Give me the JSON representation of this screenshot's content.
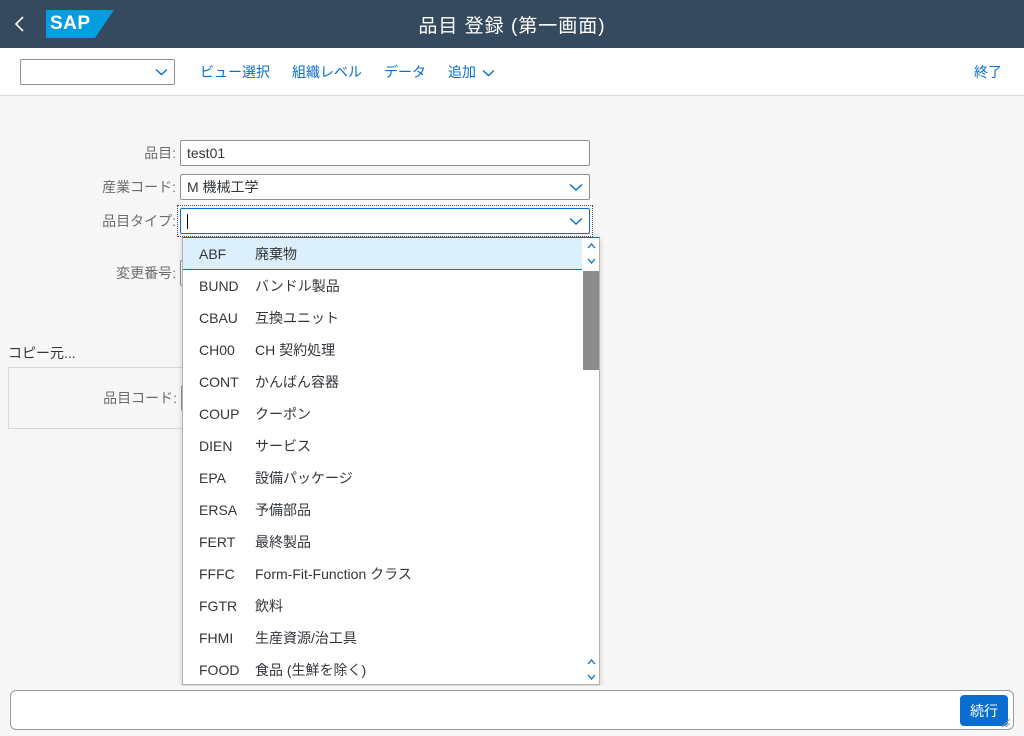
{
  "header": {
    "back_icon": "chevron-left-icon",
    "logo_text": "SAP",
    "title": "品目 登録 (第一画面)"
  },
  "toolbar": {
    "variant_value": "",
    "items": [
      {
        "label": "ビュー選択",
        "has_menu": false
      },
      {
        "label": "組織レベル",
        "has_menu": false
      },
      {
        "label": "データ",
        "has_menu": false
      },
      {
        "label": "追加",
        "has_menu": true
      }
    ],
    "exit_label": "終了"
  },
  "form": {
    "fields": [
      {
        "label": "品目:",
        "value": "test01",
        "type": "text"
      },
      {
        "label": "産業コード:",
        "value": "M 機械工学",
        "type": "combo"
      },
      {
        "label": "品目タイプ:",
        "value": "",
        "type": "combo-focused"
      },
      {
        "label": "変更番号:",
        "value": "",
        "type": "text"
      }
    ]
  },
  "copy_from": {
    "title": "コピー元...",
    "field_label": "品目コード:",
    "field_value": ""
  },
  "dropdown": {
    "selected_index": 0,
    "items": [
      {
        "code": "ABF",
        "text": "廃棄物"
      },
      {
        "code": "BUND",
        "text": "バンドル製品"
      },
      {
        "code": "CBAU",
        "text": "互換ユニット"
      },
      {
        "code": "CH00",
        "text": "CH 契約処理"
      },
      {
        "code": "CONT",
        "text": "かんばん容器"
      },
      {
        "code": "COUP",
        "text": "クーポン"
      },
      {
        "code": "DIEN",
        "text": "サービス"
      },
      {
        "code": "EPA",
        "text": "設備パッケージ"
      },
      {
        "code": "ERSA",
        "text": "予備部品"
      },
      {
        "code": "FERT",
        "text": "最終製品"
      },
      {
        "code": "FFFC",
        "text": "Form-Fit-Function クラス"
      },
      {
        "code": "FGTR",
        "text": "飲料"
      },
      {
        "code": "FHMI",
        "text": "生産資源/治工具"
      },
      {
        "code": "FOOD",
        "text": "食品 (生鮮を除く)"
      }
    ]
  },
  "footer": {
    "message": "",
    "continue_label": "続行"
  },
  "colors": {
    "shell_bg": "#354a5f",
    "brand_blue": "#049ddf",
    "accent": "#0a6ed1",
    "canvas": "#f7f7f7",
    "selection": "#dceffc"
  }
}
